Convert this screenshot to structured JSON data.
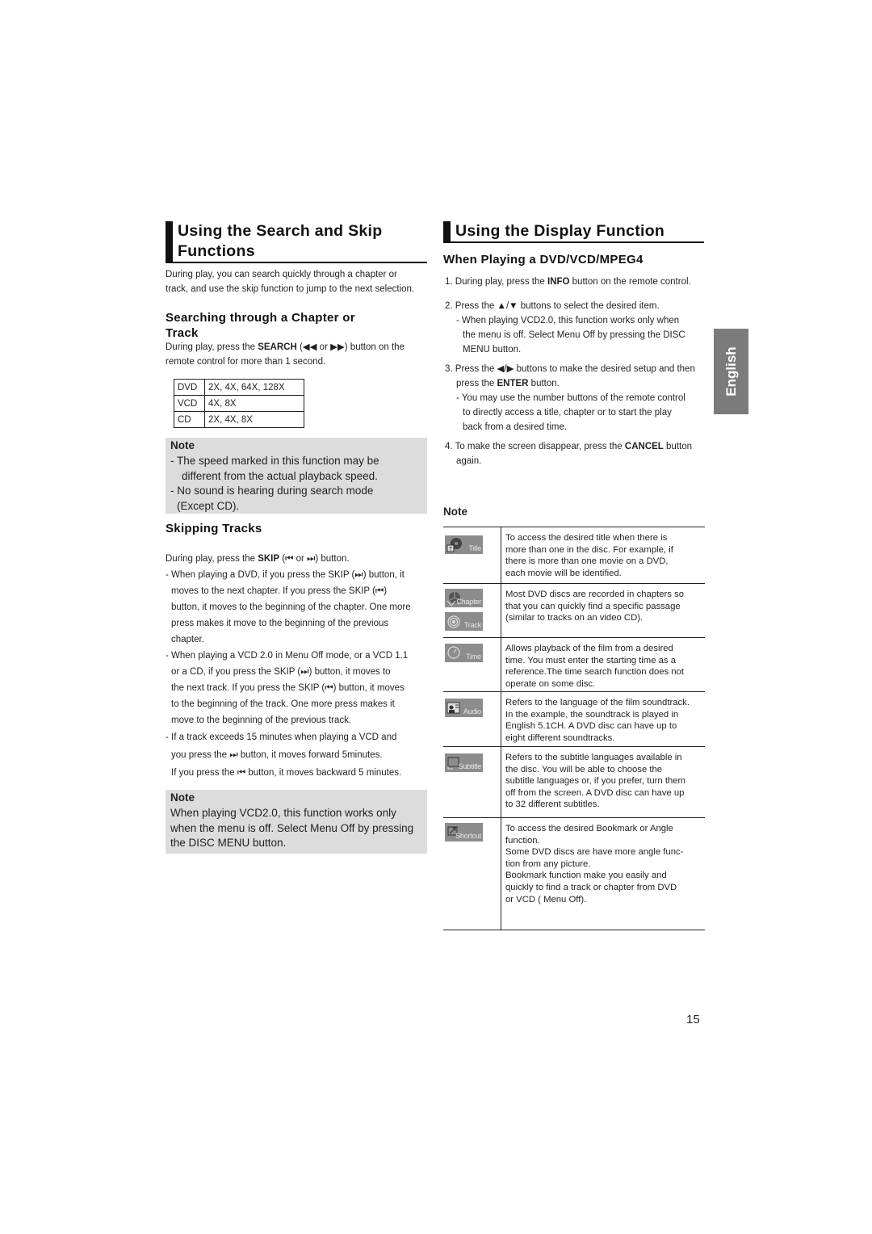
{
  "left": {
    "section_title_line1": "Using the Search and Skip",
    "section_title_line2": "Functions",
    "intro_line1": "During play, you can search quickly through a chapter or",
    "intro_line2": "track, and use the skip function to jump to the next selection.",
    "search": {
      "heading_line1": "Searching through a Chapter or",
      "heading_line2": "Track",
      "text_pre": "During play, press the ",
      "text_bold": "SEARCH",
      "text_mid": " (◀◀ or ▶▶) button on the",
      "text_line2": "remote control for more than 1 second.",
      "table": [
        {
          "disc": "DVD",
          "speeds": "2X, 4X, 64X, 128X"
        },
        {
          "disc": "VCD",
          "speeds": "4X, 8X"
        },
        {
          "disc": "CD",
          "speeds": "2X, 4X, 8X"
        }
      ]
    },
    "note1": {
      "title": "Note",
      "line1": "- The speed marked in this function may be",
      "line2": "different from the actual playback speed.",
      "line3": "- No sound is hearing during search mode",
      "line4": "(Except CD)."
    },
    "skip": {
      "heading": "Skipping Tracks",
      "intro_pre": "During play, press the ",
      "intro_bold": "SKIP",
      "intro_mid": " (⏮ or ⏭) button.",
      "bullets": [
        [
          "- When playing a DVD, if you press the SKIP (⏭) button, it",
          "moves to the next chapter. If you press the SKIP (⏮)",
          "button, it moves to the beginning of the chapter. One more",
          "press makes it move to the beginning of the previous",
          "chapter."
        ],
        [
          "- When playing a VCD 2.0 in Menu Off mode, or a VCD 1.1",
          "or a CD, if you press the SKIP (⏭) button, it moves to",
          "the next track. If you press the SKIP (⏮) button, it moves",
          "to the beginning of the track. One more press makes it",
          "move to the beginning of the previous track."
        ],
        [
          "- If a track exceeds 15 minutes when playing a VCD and",
          "you press the  ⏭  button, it moves forward 5minutes.",
          "If you press the  ⏮  button, it moves backward 5 minutes."
        ]
      ]
    },
    "note2": {
      "title": "Note",
      "line1": "When playing VCD2.0, this function works only",
      "line2": "when the menu is off. Select Menu Off by pressing",
      "line3": "the DISC MENU button."
    }
  },
  "right": {
    "section_title": "Using the Display Function",
    "subheading": "When Playing a DVD/VCD/MPEG4",
    "steps": {
      "s1_pre": "1. During play, press the ",
      "s1_bold": "INFO",
      "s1_post": " button on the remote control.",
      "s2": "2. Press the ▲/▼ buttons to select the desired item.",
      "s2_sub1": "- When playing VCD2.0, this function works only when",
      "s2_sub2": "the menu is off. Select Menu Off by pressing the DISC",
      "s2_sub3": "MENU button.",
      "s3_pre": "3. Press the ◀/▶ buttons to make the desired setup and then",
      "s3_l2_pre": "press the ",
      "s3_l2_bold": "ENTER",
      "s3_l2_post": " button.",
      "s3_sub1": "- You may use the number buttons of the remote control",
      "s3_sub2": "to directly access a title, chapter or to start the play",
      "s3_sub3": "back from a desired time.",
      "s4_pre": "4. To make the screen disappear, press the ",
      "s4_bold": "CANCEL",
      "s4_post": " button",
      "s4_l2": "again."
    },
    "note_title": "Note",
    "display_items": [
      {
        "icons": [
          {
            "name": "title-icon",
            "label": "Title"
          }
        ],
        "lines": [
          "To access the desired title when there is",
          "more than one in the disc. For example, if",
          "there is more than one movie on a DVD,",
          "each movie will be identified."
        ]
      },
      {
        "icons": [
          {
            "name": "chapter-icon",
            "label": "Chapter"
          },
          {
            "name": "track-icon",
            "label": "Track"
          }
        ],
        "lines": [
          "Most DVD discs are recorded in chapters so",
          "that you can quickly find a specific passage",
          "(similar to tracks on an video CD)."
        ]
      },
      {
        "icons": [
          {
            "name": "time-icon",
            "label": "Time"
          }
        ],
        "lines": [
          "Allows playback of the film from a desired",
          "time. You must enter the starting time as a",
          "reference.The time search function does not",
          "operate on some disc."
        ]
      },
      {
        "icons": [
          {
            "name": "audio-icon",
            "label": "Audio"
          }
        ],
        "lines": [
          "Refers to the language of the film soundtrack.",
          "In the example, the soundtrack is played in",
          "English 5.1CH. A DVD disc can have up to",
          "eight different soundtracks."
        ]
      },
      {
        "icons": [
          {
            "name": "subtitle-icon",
            "label": "Subtitle"
          }
        ],
        "lines": [
          "Refers to the subtitle languages available in",
          "the disc. You will be able to choose the",
          "subtitle languages or, if you prefer, turn them",
          "off from the screen. A DVD disc can have up",
          "to 32 different subtitles."
        ]
      },
      {
        "icons": [
          {
            "name": "shortcut-icon",
            "label": "Shortcut"
          }
        ],
        "lines": [
          "To access the desired Bookmark or Angle",
          "function.",
          "Some DVD discs are have more angle func-",
          "tion from any picture.",
          "Bookmark function make you easily and",
          "quickly to find a track or chapter from DVD",
          "or VCD ( Menu Off)."
        ]
      }
    ]
  },
  "language_tab": "English",
  "page_number": "15"
}
